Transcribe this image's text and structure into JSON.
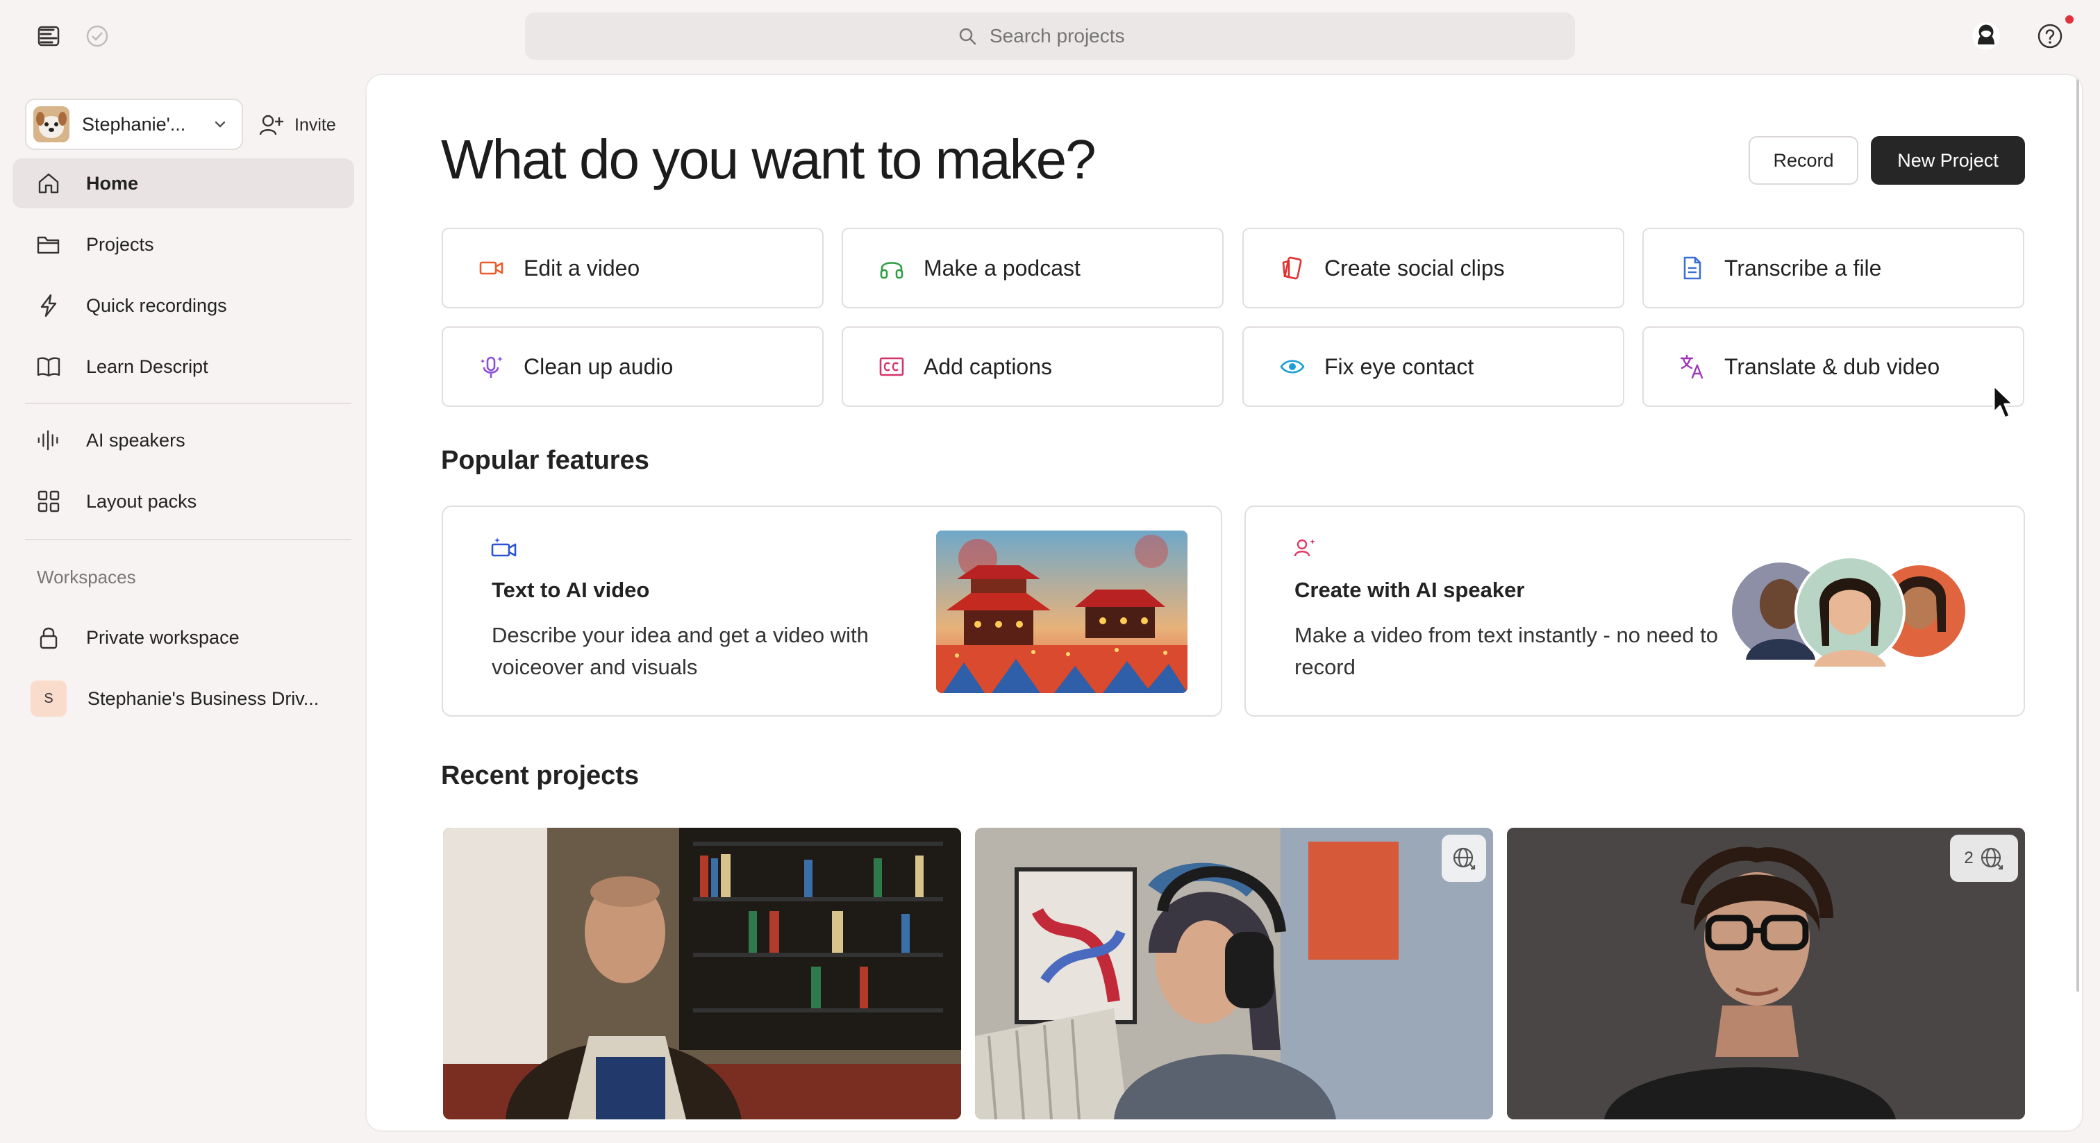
{
  "topbar": {
    "menu_icon": "sidebar-toggle-icon",
    "status_icon": "check-circle-icon",
    "search": {
      "placeholder": "Search projects",
      "value": ""
    },
    "profile_icon": "user-profile-icon",
    "help_icon": "help-icon",
    "notification_color": "#e0323c"
  },
  "sidebar": {
    "workspace_switcher": {
      "name": "Stephanie'...",
      "icon": "chevron-down-icon"
    },
    "invite_label": "Invite",
    "nav": [
      {
        "label": "Home",
        "icon": "home-icon",
        "active": true
      },
      {
        "label": "Projects",
        "icon": "folder-icon"
      },
      {
        "label": "Quick recordings",
        "icon": "lightning-icon"
      },
      {
        "label": "Learn Descript",
        "icon": "book-icon"
      },
      {
        "label": "AI speakers",
        "icon": "waveform-icon"
      },
      {
        "label": "Layout packs",
        "icon": "grid-icon"
      }
    ],
    "workspaces_heading": "Workspaces",
    "workspaces": [
      {
        "label": "Private workspace",
        "icon": "lock-icon"
      },
      {
        "label": "Stephanie's Business Driv...",
        "badge": "S"
      }
    ]
  },
  "main": {
    "headline": "What do you want to make?",
    "record_label": "Record",
    "new_project_label": "New Project",
    "actions": [
      {
        "label": "Edit a video",
        "icon": "video-camera-icon",
        "color": "#ef5a2b"
      },
      {
        "label": "Make a podcast",
        "icon": "headphones-icon",
        "color": "#2f9e44"
      },
      {
        "label": "Create social clips",
        "icon": "social-clips-icon",
        "color": "#e03131"
      },
      {
        "label": "Transcribe a file",
        "icon": "document-icon",
        "color": "#3b6fd8"
      },
      {
        "label": "Clean up audio",
        "icon": "microphone-sparkle-icon",
        "color": "#8a4fd8"
      },
      {
        "label": "Add captions",
        "icon": "captions-icon",
        "color": "#d6336c"
      },
      {
        "label": "Fix eye contact",
        "icon": "eye-icon",
        "color": "#1c9fd6"
      },
      {
        "label": "Translate & dub video",
        "icon": "translate-icon",
        "color": "#9c36b5"
      }
    ],
    "popular_title": "Popular features",
    "features": [
      {
        "title": "Text to AI video",
        "description": "Describe your idea and get a video with voiceover and visuals",
        "icon": "text-to-video-icon",
        "image": "pagoda-illustration"
      },
      {
        "title": "Create with AI speaker",
        "description": "Make a video from text instantly - no need to record",
        "icon": "ai-speaker-icon",
        "image": "speaker-avatars"
      }
    ],
    "recent_title": "Recent projects",
    "projects": [
      {
        "thumbnail": "man-with-bookshelf",
        "badge_count": ""
      },
      {
        "thumbnail": "woman-with-headphones",
        "badge_count": ""
      },
      {
        "thumbnail": "woman-with-glasses",
        "badge_count": "2"
      }
    ]
  }
}
